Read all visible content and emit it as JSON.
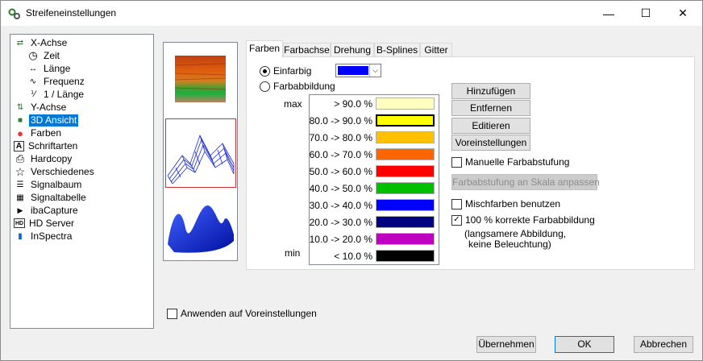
{
  "window": {
    "title": "Streifeneinstellungen",
    "minimize_glyph": "—",
    "maximize_glyph": "☐",
    "close_glyph": "✕"
  },
  "tree": [
    {
      "label": "X-Achse",
      "icon": "x-axis-icon",
      "glyph": "⇄"
    },
    {
      "label": "Zeit",
      "icon": "clock-icon",
      "glyph": "◷"
    },
    {
      "label": "Länge",
      "icon": "length-icon",
      "glyph": "↔"
    },
    {
      "label": "Frequenz",
      "icon": "frequency-icon",
      "glyph": "∿"
    },
    {
      "label": "1 / Länge",
      "icon": "inverse-length-icon",
      "glyph": "⅟"
    },
    {
      "label": "Y-Achse",
      "icon": "y-axis-icon",
      "glyph": "⇅"
    },
    {
      "label": "3D Ansicht",
      "icon": "cube-3d-icon",
      "glyph": "■"
    },
    {
      "label": "Farben",
      "icon": "colors-icon",
      "glyph": "●"
    },
    {
      "label": "Schriftarten",
      "icon": "font-icon",
      "glyph": "A"
    },
    {
      "label": "Hardcopy",
      "icon": "printer-icon",
      "glyph": "⎙"
    },
    {
      "label": "Verschiedenes",
      "icon": "star-icon",
      "glyph": "☆"
    },
    {
      "label": "Signalbaum",
      "icon": "signal-tree-icon",
      "glyph": "☰"
    },
    {
      "label": "Signaltabelle",
      "icon": "table-icon",
      "glyph": "▦"
    },
    {
      "label": "ibaCapture",
      "icon": "camera-icon",
      "glyph": "▶"
    },
    {
      "label": "HD Server",
      "icon": "hd-server-icon",
      "glyph": "HD"
    },
    {
      "label": "InSpectra",
      "icon": "spectrum-icon",
      "glyph": "▮"
    }
  ],
  "tabs": [
    "Farben",
    "Farbachse",
    "Drehung",
    "B-Splines",
    "Gitter"
  ],
  "mode": {
    "single_label": "Einfarbig",
    "multi_label": "Farbabbildung",
    "selected": "Einfarbig",
    "single_color": "#0000ff"
  },
  "scale": {
    "max_label": "max",
    "min_label": "min",
    "rows": [
      {
        "label": "> 90.0 %",
        "color": "#ffffc0"
      },
      {
        "label": "80.0 -> 90.0 %",
        "color": "#ffff00"
      },
      {
        "label": "70.0 -> 80.0 %",
        "color": "#ffc000"
      },
      {
        "label": "60.0 -> 70.0 %",
        "color": "#ff6600"
      },
      {
        "label": "50.0 -> 60.0 %",
        "color": "#ff0000"
      },
      {
        "label": "40.0 -> 50.0 %",
        "color": "#00c000"
      },
      {
        "label": "30.0 -> 40.0 %",
        "color": "#0000ff"
      },
      {
        "label": "20.0 -> 30.0 %",
        "color": "#000080"
      },
      {
        "label": "10.0 -> 20.0 %",
        "color": "#c000c0"
      },
      {
        "label": "< 10.0 %",
        "color": "#000000"
      }
    ]
  },
  "buttons": {
    "add": "Hinzufügen",
    "remove": "Entfernen",
    "edit": "Editieren",
    "defaults": "Voreinstellungen",
    "fit_scale": "Farbabstufung an Skala anpassen"
  },
  "options": {
    "manual_gradient": "Manuelle Farbabstufung",
    "blend_colors": "Mischfarben benutzen",
    "correct_mapping": "100 % korrekte Farbabbildung",
    "correct_mapping_note_1": "(langsamere Abbildung,",
    "correct_mapping_note_2": "keine Beleuchtung)"
  },
  "apply_to_defaults": "Anwenden auf Voreinstellungen",
  "footer": {
    "apply": "Übernehmen",
    "ok": "OK",
    "cancel": "Abbrechen"
  },
  "colors": {
    "selection": "#0078d7",
    "preview_border": "#d03030"
  }
}
